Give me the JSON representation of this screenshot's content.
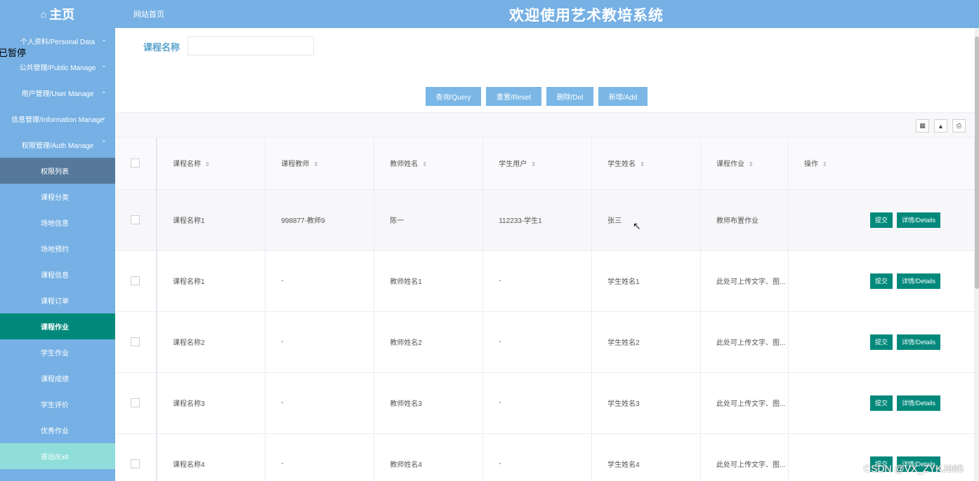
{
  "header": {
    "home_icon": "home-icon",
    "home_label": "主页",
    "site_link": "网站首页",
    "app_title": "欢迎使用艺术教培系统"
  },
  "sidebar": {
    "groups": [
      {
        "label": "个人资料/Personal Data"
      },
      {
        "label": "公共管理/Public Manage"
      },
      {
        "label": "用户管理/User Manage"
      },
      {
        "label": "信息管理/Information Manage"
      },
      {
        "label": "权限管理/Auth Manage"
      }
    ],
    "items": [
      {
        "label": "权限列表"
      },
      {
        "label": "课程分类"
      },
      {
        "label": "场地信息"
      },
      {
        "label": "场地预约"
      },
      {
        "label": "课程信息"
      },
      {
        "label": "课程订单"
      },
      {
        "label": "课程作业"
      },
      {
        "label": "学生作业"
      },
      {
        "label": "课程成绩"
      },
      {
        "label": "学生评价"
      },
      {
        "label": "优秀作业"
      },
      {
        "label": "退出/Exit"
      }
    ],
    "overlay_text": "已暂停"
  },
  "search": {
    "label": "课程名称",
    "value": "",
    "placeholder": ""
  },
  "actions": {
    "query": "查询/Query",
    "reset": "重置/Reset",
    "delete": "删除/Del",
    "add": "新增/Add"
  },
  "toolbar": {
    "icons": [
      "columns-icon",
      "export-icon",
      "print-icon"
    ]
  },
  "table": {
    "headers": [
      "课程名称",
      "课程教师",
      "教师姓名",
      "学生用户",
      "学生姓名",
      "课程作业",
      "操作"
    ],
    "rows": [
      [
        "课程名称1",
        "998877-教师9",
        "陈一",
        "112233-学生1",
        "张三",
        "教师布置作业"
      ],
      [
        "课程名称1",
        "-",
        "教师姓名1",
        "-",
        "学生姓名1",
        "此处可上传文字、图..."
      ],
      [
        "课程名称2",
        "-",
        "教师姓名2",
        "-",
        "学生姓名2",
        "此处可上传文字、图..."
      ],
      [
        "课程名称3",
        "-",
        "教师姓名3",
        "-",
        "学生姓名3",
        "此处可上传文字、图..."
      ],
      [
        "课程名称4",
        "-",
        "教师姓名4",
        "-",
        "学生姓名4",
        "此处可上传文字、图..."
      ]
    ],
    "row_actions": {
      "submit": "提交",
      "details": "详情/Details"
    }
  },
  "watermark": "CSDN @VX_ZYKJ985",
  "colors": {
    "header_bg": "#76b0e4",
    "active_item": "#00897b",
    "hover_item": "#56799b",
    "exit_item": "#8fded9",
    "button": "#7ab7e6",
    "action_button": "#00897b"
  }
}
